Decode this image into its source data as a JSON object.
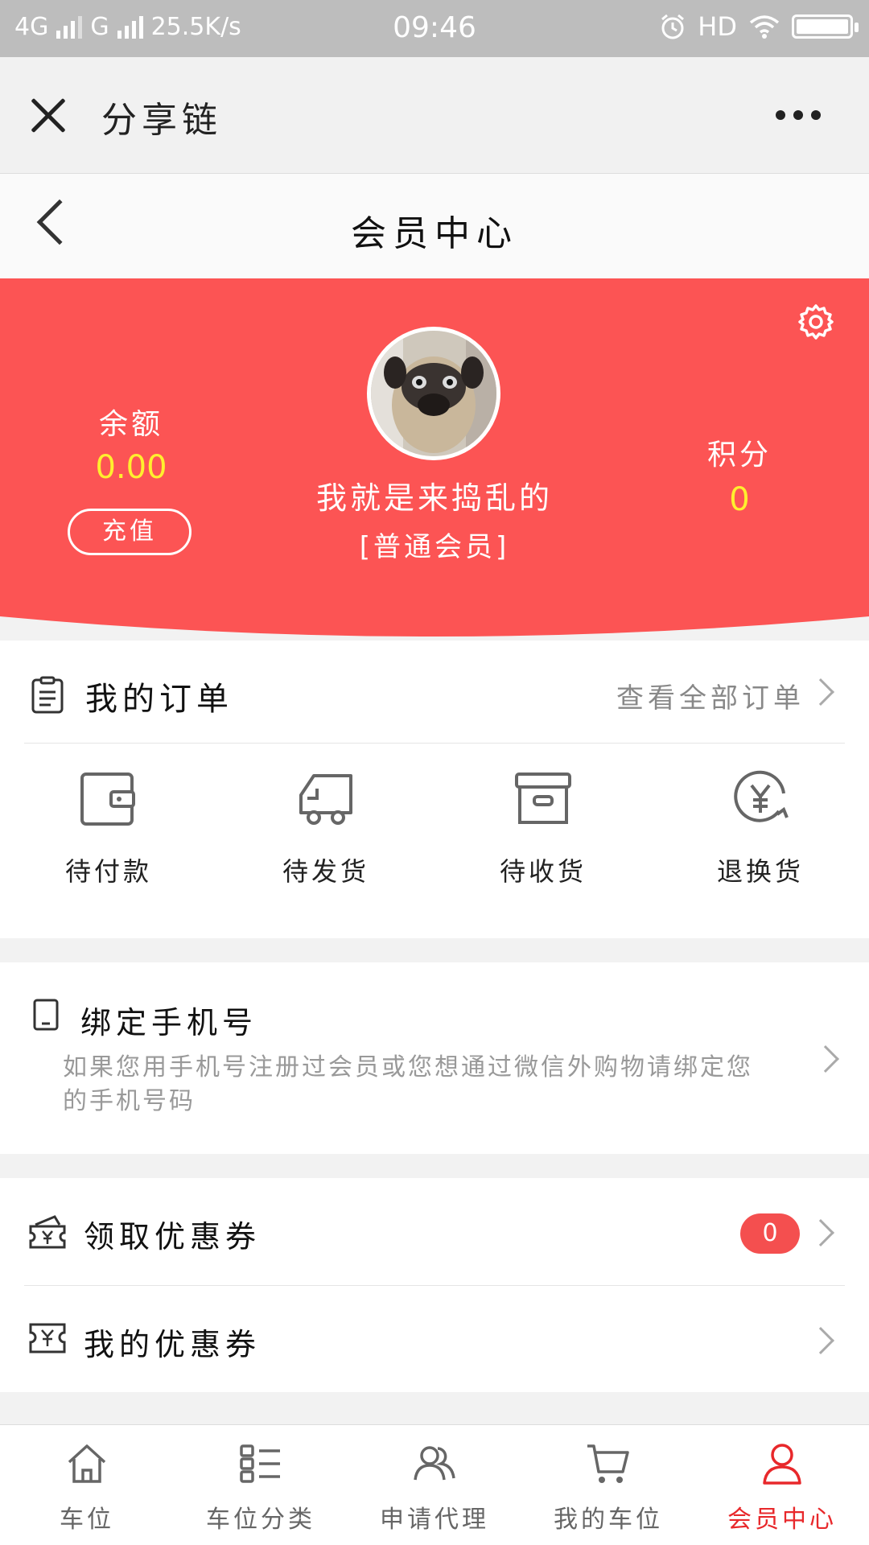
{
  "status_bar": {
    "network1": "4G",
    "network2": "G",
    "speed": "25.5K/s",
    "time": "09:46",
    "hd": "HD"
  },
  "wechat_bar": {
    "title": "分享链",
    "close_icon": "close-icon",
    "more_icon": "more-icon"
  },
  "header": {
    "title": "会员中心",
    "back_icon": "back-arrow-icon"
  },
  "profile": {
    "nickname": "我就是来捣乱的",
    "level": "[普通会员]",
    "balance_label": "余额",
    "balance_value": "0.00",
    "recharge_label": "充值",
    "points_label": "积分",
    "points_value": "0",
    "settings_icon": "gear-icon",
    "banner_color": "#fc5454",
    "value_color": "#ffef2e"
  },
  "orders": {
    "title": "我的订单",
    "view_all": "查看全部订单",
    "statuses": [
      {
        "label": "待付款",
        "icon": "wallet-icon"
      },
      {
        "label": "待发货",
        "icon": "truck-icon"
      },
      {
        "label": "待收货",
        "icon": "box-icon"
      },
      {
        "label": "退换货",
        "icon": "refund-icon"
      }
    ]
  },
  "bind_phone": {
    "title": "绑定手机号",
    "description": "如果您用手机号注册过会员或您想通过微信外购物请绑定您的手机号码"
  },
  "coupons": {
    "claim_label": "领取优惠券",
    "claim_count": "0",
    "mine_label": "我的优惠券"
  },
  "tabbar": {
    "items": [
      {
        "label": "车位",
        "icon": "home-icon",
        "active": false
      },
      {
        "label": "车位分类",
        "icon": "category-icon",
        "active": false
      },
      {
        "label": "申请代理",
        "icon": "users-icon",
        "active": false
      },
      {
        "label": "我的车位",
        "icon": "cart-icon",
        "active": false
      },
      {
        "label": "会员中心",
        "icon": "user-icon",
        "active": true
      }
    ],
    "active_color": "#e8282b"
  }
}
